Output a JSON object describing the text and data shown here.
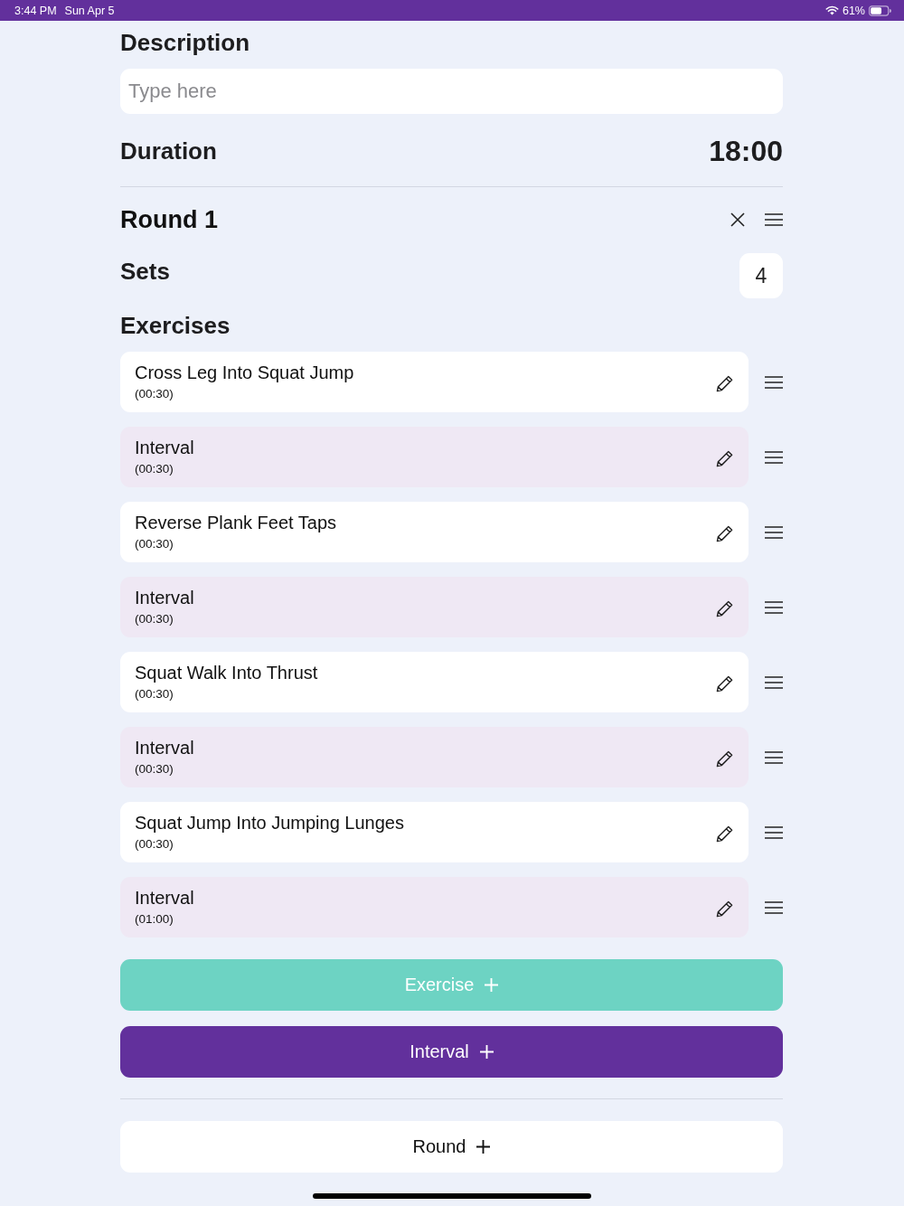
{
  "status_bar": {
    "time": "3:44 PM",
    "date": "Sun Apr 5",
    "battery": "61%"
  },
  "description": {
    "label": "Description",
    "placeholder": "Type here"
  },
  "duration": {
    "label": "Duration",
    "value": "18:00"
  },
  "rounds": [
    {
      "title": "Round 1",
      "sets_label": "Sets",
      "sets": "4",
      "exercises_label": "Exercises",
      "exercises": [
        {
          "kind": "exercise",
          "name": "Cross Leg Into Squat Jump",
          "duration": "(00:30)"
        },
        {
          "kind": "interval",
          "name": "Interval",
          "duration": "(00:30)"
        },
        {
          "kind": "exercise",
          "name": "Reverse Plank Feet Taps",
          "duration": "(00:30)"
        },
        {
          "kind": "interval",
          "name": "Interval",
          "duration": "(00:30)"
        },
        {
          "kind": "exercise",
          "name": "Squat Walk Into Thrust",
          "duration": "(00:30)"
        },
        {
          "kind": "interval",
          "name": "Interval",
          "duration": "(00:30)"
        },
        {
          "kind": "exercise",
          "name": "Squat Jump Into Jumping Lunges",
          "duration": "(00:30)"
        },
        {
          "kind": "interval",
          "name": "Interval",
          "duration": "(01:00)"
        }
      ],
      "buttons": [
        {
          "kind": "exercise",
          "label": "Exercise"
        },
        {
          "kind": "interval",
          "label": "Interval"
        }
      ]
    }
  ],
  "add_round": {
    "label": "Round"
  }
}
